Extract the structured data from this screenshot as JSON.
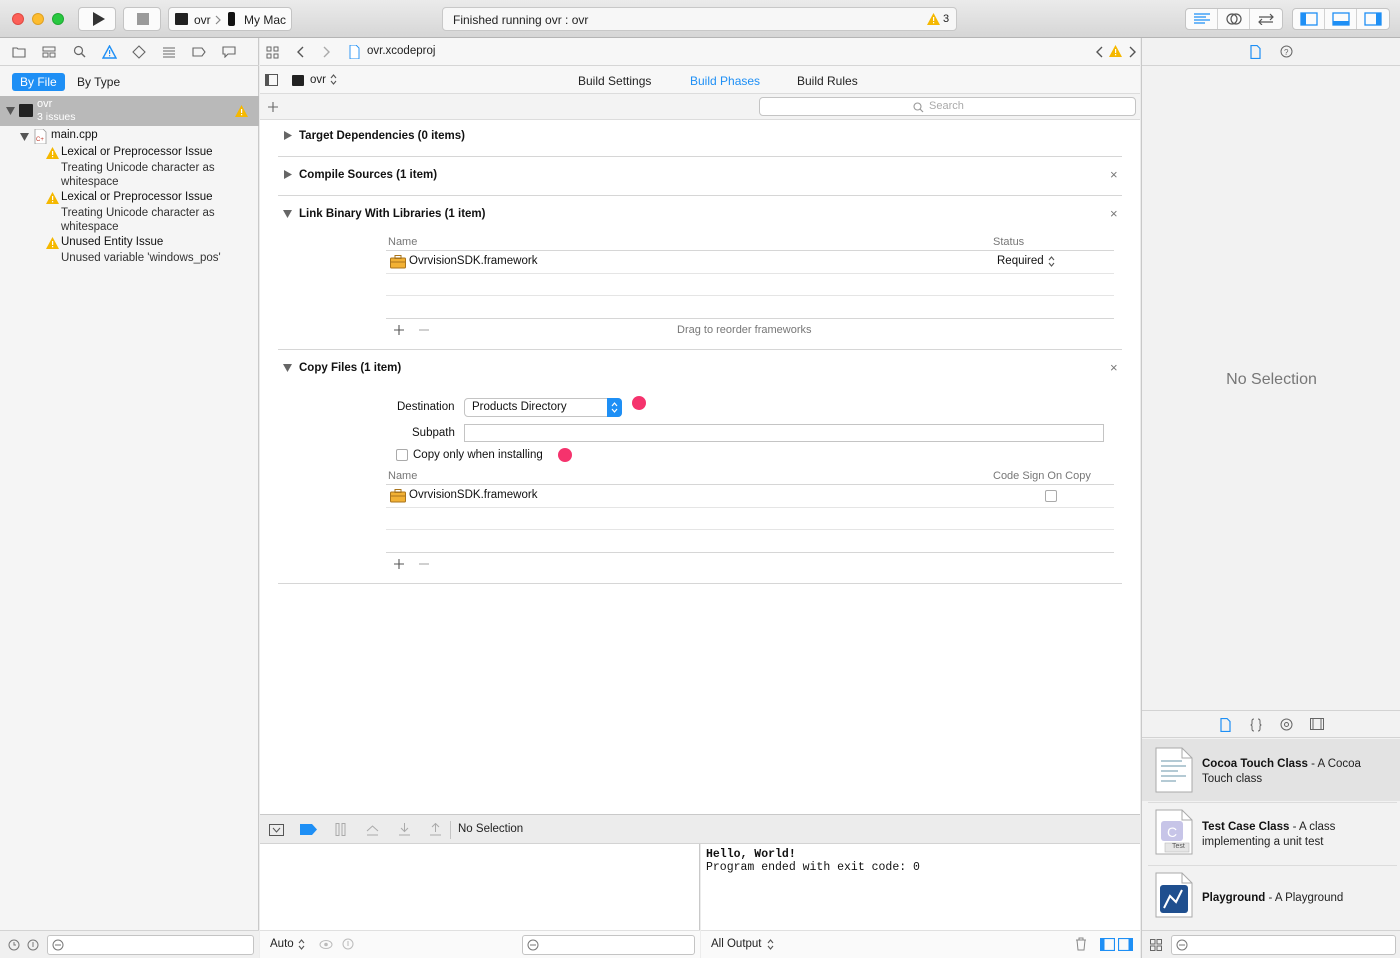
{
  "toolbar": {
    "scheme_target": "ovr",
    "scheme_device": "My Mac",
    "activity_text": "Finished running ovr : ovr",
    "warning_count": "3"
  },
  "navigator": {
    "filter_tabs": [
      "By File",
      "By Type"
    ],
    "project": {
      "name": "ovr",
      "issues": "3 issues"
    },
    "file": "main.cpp",
    "issues": [
      {
        "title": "Lexical or Preprocessor Issue",
        "lines": [
          "Treating Unicode character as",
          "whitespace"
        ]
      },
      {
        "title": "Lexical or Preprocessor Issue",
        "lines": [
          "Treating Unicode character as",
          "whitespace"
        ]
      },
      {
        "title": "Unused Entity Issue",
        "lines": [
          "Unused variable 'windows_pos'"
        ]
      }
    ]
  },
  "editor": {
    "jump_file": "ovr.xcodeproj",
    "target": "ovr",
    "tabs": [
      "Build Settings",
      "Build Phases",
      "Build Rules"
    ],
    "active_tab": "Build Phases",
    "search_placeholder": "Search",
    "phases": {
      "target_deps": "Target Dependencies (0 items)",
      "compile_sources": "Compile Sources (1 item)",
      "link_binary": {
        "title": "Link Binary With Libraries (1 item)",
        "col_name": "Name",
        "col_status": "Status",
        "row_name": "OvrvisionSDK.framework",
        "row_status": "Required",
        "footer_hint": "Drag to reorder frameworks"
      },
      "copy_files": {
        "title": "Copy Files (1 item)",
        "destination_label": "Destination",
        "destination_value": "Products Directory",
        "subpath_label": "Subpath",
        "subpath_value": "",
        "copy_only_label": "Copy only when installing",
        "col_name": "Name",
        "col_code_sign": "Code Sign On Copy",
        "row_name": "OvrvisionSDK.framework"
      }
    }
  },
  "debug": {
    "status": "No Selection",
    "auto_label": "Auto",
    "all_output_label": "All Output",
    "console_lines": [
      "Hello, World!",
      "Program ended with exit code: 0"
    ]
  },
  "inspector": {
    "no_selection": "No Selection",
    "library": [
      {
        "title": "Cocoa Touch Class",
        "desc_line1": " - A Cocoa",
        "desc_line2": "Touch class"
      },
      {
        "title": "Test Case Class",
        "desc_line1": " - A class",
        "desc_line2": "implementing a unit test"
      },
      {
        "title": "Playground",
        "desc_line1": " - A Playground",
        "desc_line2": ""
      }
    ],
    "test_badge": "Test"
  },
  "colors": {
    "accent": "#1e8ff5",
    "warning": "#f5b800",
    "pink_marker": "#f5336d"
  }
}
